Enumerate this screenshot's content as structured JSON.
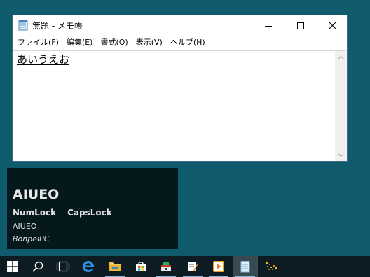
{
  "window": {
    "title": "無題 - メモ帳",
    "menu": [
      "ファイル(F)",
      "編集(E)",
      "書式(O)",
      "表示(V)",
      "ヘルプ(H)"
    ],
    "content": "あいうえお"
  },
  "panel": {
    "title": "AIUEO",
    "numlock": "NumLock",
    "capslock": "CapsLock",
    "line1": "AIUEO",
    "line2": "BonpeiPC"
  },
  "taskbar": {
    "items": [
      "windows-start-icon",
      "search-icon",
      "task-view-icon",
      "edge-icon",
      "file-explorer-icon",
      "store-icon",
      "app-icon-green",
      "app-icon-notes",
      "app-icon-media",
      "notepad-icon",
      "app-icon-fpp"
    ]
  },
  "colors": {
    "desktop": "#0f5a6c",
    "taskbar": "#0d1b22",
    "panel": "#05181c"
  }
}
